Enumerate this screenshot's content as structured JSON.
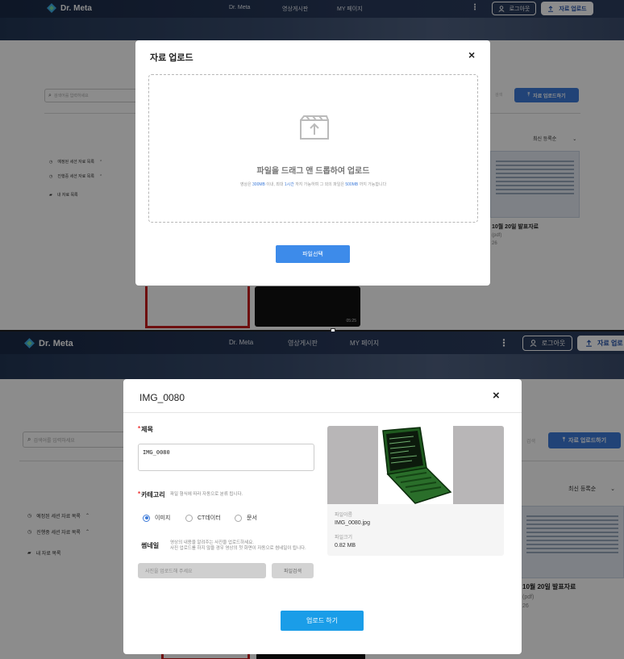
{
  "top": {
    "brand": "Dr. Meta",
    "nav": [
      "Dr. Meta",
      "영상게시판",
      "MY 페이지"
    ],
    "logout_label": "로그아웃",
    "upload_label": "자료 업로드",
    "background": {
      "search_placeholder": "검색어를 입력하세요",
      "upload_button": "자료 업로드하기",
      "faint": "검색",
      "sidebar": [
        "예정된 세션 자료 목록",
        "진행중 세션 자료 목록",
        "내 자료 목록"
      ],
      "sort": "최신 등록순",
      "card_title": "10월 20일 발표자료",
      "card_sub": "(pdf)",
      "card_num": "26",
      "video_time": "05:25"
    },
    "modal": {
      "title": "자료 업로드",
      "close": "×",
      "drop_title": "파일을 드래그 앤 드롭하여 업로드",
      "drop_note_1": "영상은 ",
      "drop_note_2": "300MB",
      "drop_note_3": " 이내, 최대 ",
      "drop_note_4": "1시간",
      "drop_note_5": " 까지 가능하며 그 외의 파일은 ",
      "drop_note_6": "500MB",
      "drop_note_7": " 까지 가능합니다",
      "select_button": "파일선택"
    }
  },
  "bottom": {
    "brand": "Dr. Meta",
    "nav": [
      "Dr. Meta",
      "영상게시판",
      "MY 페이지"
    ],
    "logout_label": "로그아웃",
    "upload_label": "자료 업로",
    "background": {
      "search_placeholder": "검색어를 입력하세요",
      "upload_button": "자료 업로드하기",
      "faint": "검색",
      "sidebar": [
        "예정된 세션 자료 목록",
        "진행중 세션 자료 목록",
        "내 자료 목록"
      ],
      "sort": "최신 등록순",
      "card_title": "10월 20일 발표자료",
      "card_sub": "(pdf)",
      "card_num": "26"
    },
    "modal": {
      "title": "IMG_0080",
      "close": "×",
      "title_label": "제목",
      "title_value": "IMG_0080",
      "category_label": "카테고리",
      "category_hint": "파일 형식에 따라 자동으로 분류 됩니다.",
      "category_options": [
        "이미지",
        "CT데이터",
        "문서"
      ],
      "category_selected": "이미지",
      "thumbnail_label": "썸네일",
      "thumbnail_hint_1": "영상의 내용을 알려주는 사진을 업로드하세요.",
      "thumbnail_hint_2": "사진 업로드를 하지 않을 경우 영상의 첫 화면이 자동으로 썸네일이 됩니다.",
      "thumbnail_placeholder": "사진을 업로드해 주세요",
      "browse_button": "파일검색",
      "file_name_label": "파일이름",
      "file_name": "IMG_0080.jpg",
      "file_size_label": "파일크기",
      "file_size": "0.82 MB",
      "submit_button": "업로드 하기"
    }
  },
  "colors": {
    "primary": "#3d8bea",
    "submit": "#1a9de8",
    "nav": "#1a2a47"
  }
}
